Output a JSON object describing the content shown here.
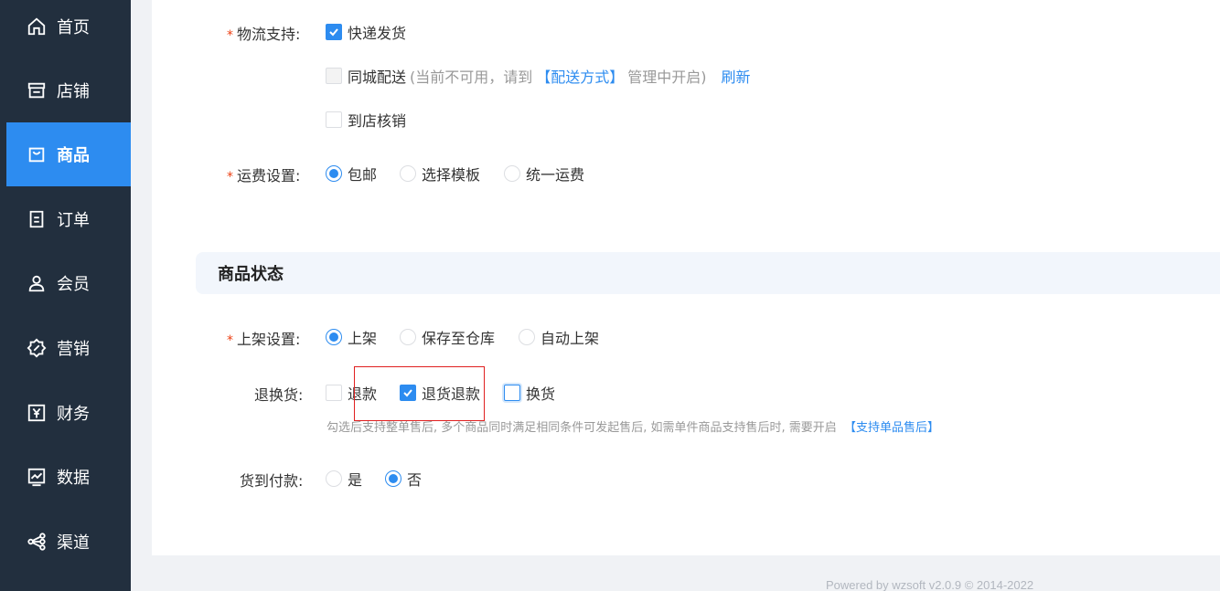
{
  "sidebar": {
    "items": [
      {
        "label": "首页",
        "icon": "home-icon"
      },
      {
        "label": "店铺",
        "icon": "store-icon"
      },
      {
        "label": "商品",
        "icon": "shopping-bag-icon",
        "active": true
      },
      {
        "label": "订单",
        "icon": "order-icon"
      },
      {
        "label": "会员",
        "icon": "user-icon"
      },
      {
        "label": "营销",
        "icon": "marketing-icon"
      },
      {
        "label": "财务",
        "icon": "yen-icon"
      },
      {
        "label": "数据",
        "icon": "chart-icon"
      },
      {
        "label": "渠道",
        "icon": "share-icon"
      }
    ]
  },
  "logistics": {
    "label": "物流支持:",
    "express": {
      "label": "快递发货",
      "checked": true
    },
    "city": {
      "label": "同城配送",
      "note_prefix": "(当前不可用，请到",
      "note_link": "【配送方式】",
      "note_suffix": "管理中开启)",
      "refresh": "刷新",
      "disabled": true
    },
    "pickup": {
      "label": "到店核销",
      "checked": false
    }
  },
  "shipping": {
    "label": "运费设置:",
    "options": [
      "包邮",
      "选择模板",
      "统一运费"
    ],
    "selected": "包邮"
  },
  "status_section": {
    "title": "商品状态"
  },
  "listing": {
    "label": "上架设置:",
    "options": [
      "上架",
      "保存至仓库",
      "自动上架"
    ],
    "selected": "上架"
  },
  "returns": {
    "label": "退换货:",
    "options": [
      {
        "label": "退款",
        "checked": false
      },
      {
        "label": "退货退款",
        "checked": true
      },
      {
        "label": "换货",
        "checked": false
      }
    ],
    "hint": "勾选后支持整单售后, 多个商品同时满足相同条件可发起售后, 如需单件商品支持售后时, 需要开启",
    "hint_link": "【支持单品售后】"
  },
  "cod": {
    "label": "货到付款:",
    "options": [
      "是",
      "否"
    ],
    "selected": "否"
  },
  "footer": {
    "text": "Powered by wzsoft v2.0.9 © 2014-2022"
  },
  "colors": {
    "sidebar_bg": "#222f3e",
    "accent": "#2d8cf0",
    "required": "#ed4014"
  }
}
